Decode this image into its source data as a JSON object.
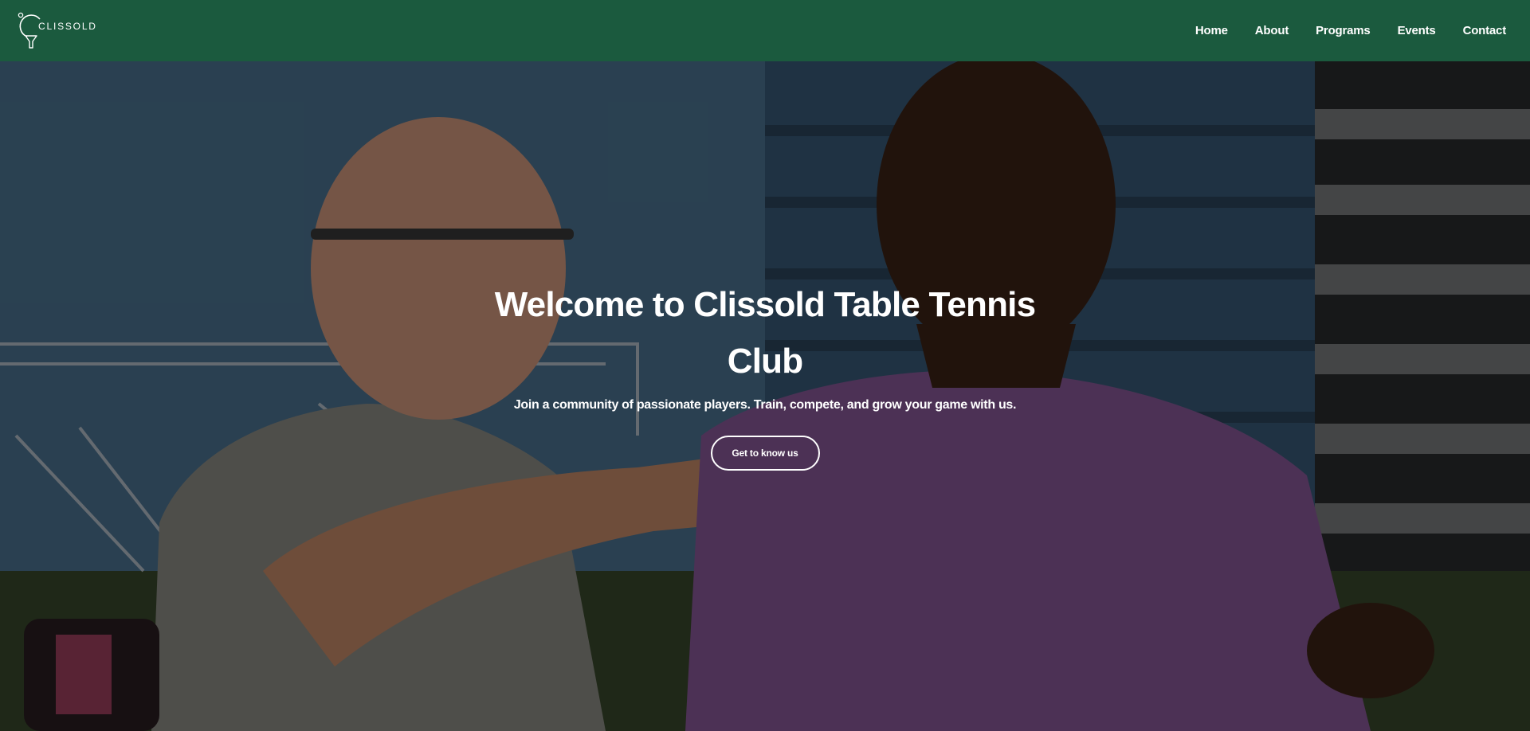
{
  "brand": {
    "name": "CLISSOLD",
    "logo_icon": "paddle-ball-icon"
  },
  "nav": {
    "items": [
      {
        "label": "Home"
      },
      {
        "label": "About"
      },
      {
        "label": "Programs"
      },
      {
        "label": "Events"
      },
      {
        "label": "Contact"
      }
    ]
  },
  "hero": {
    "title": "Welcome to Clissold Table Tennis Club",
    "subtitle": "Join a community of passionate players. Train, compete, and grow your game with us.",
    "cta_label": "Get to know us"
  },
  "colors": {
    "header_bg": "#1b5a3e",
    "text": "#ffffff",
    "overlay": "rgba(0,0,0,0.45)"
  }
}
